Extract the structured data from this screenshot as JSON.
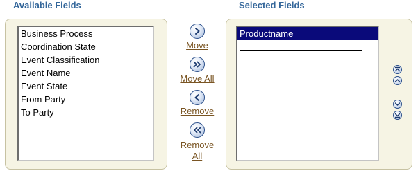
{
  "available": {
    "heading": "Available Fields",
    "items": [
      "Business Process",
      "Coordination State",
      "Event Classification",
      "Event Name",
      "Event State",
      "From Party",
      "To Party"
    ]
  },
  "selected": {
    "heading": "Selected Fields",
    "items": [
      "Productname"
    ]
  },
  "shuttle": {
    "move_label": "Move",
    "move_all_label": "Move All",
    "remove_label": "Remove",
    "remove_all_line1": "Remove",
    "remove_all_line2": "All"
  },
  "icons": {
    "move": "chevron-right-icon",
    "move_all": "double-chevron-right-icon",
    "remove": "chevron-left-icon",
    "remove_all": "double-chevron-left-icon",
    "move_top": "move-to-top-icon",
    "move_up": "move-up-icon",
    "move_down": "move-down-icon",
    "move_bottom": "move-to-bottom-icon"
  },
  "colors": {
    "heading": "#33669a",
    "panel_background": "#f6f4e4",
    "link": "#7a5523",
    "selection": "#0a0a7a"
  }
}
